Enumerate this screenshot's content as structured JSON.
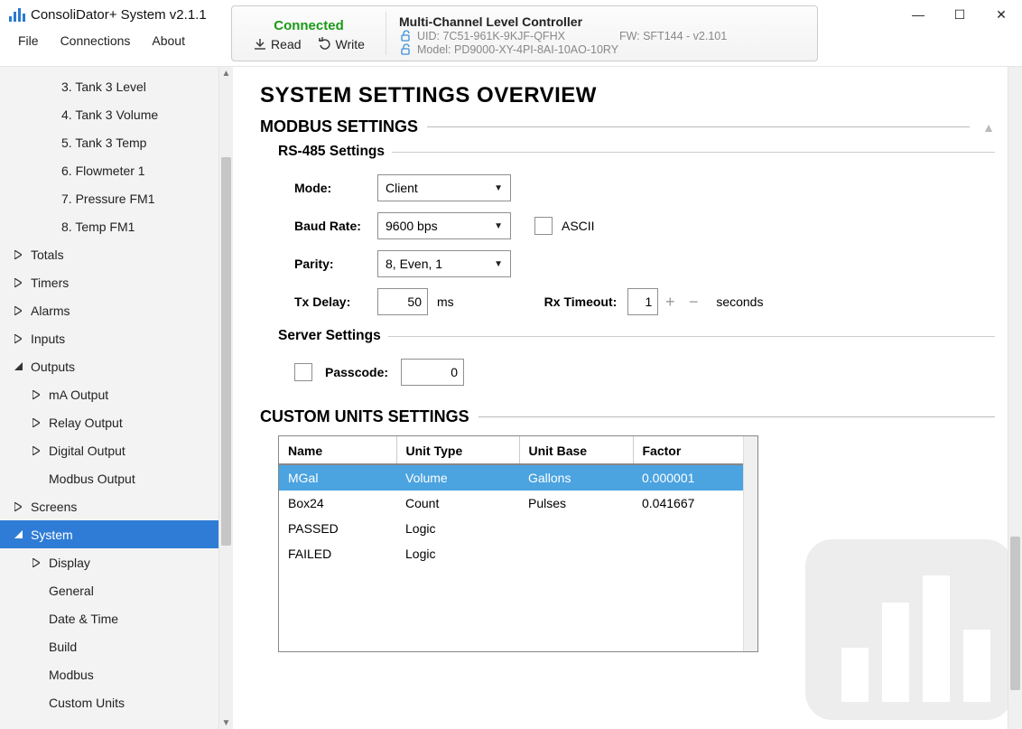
{
  "app": {
    "title": "ConsoliDator+ System v2.1.1"
  },
  "menu": {
    "file": "File",
    "connections": "Connections",
    "about": "About"
  },
  "infobar": {
    "status": "Connected",
    "read": "Read",
    "write": "Write",
    "device_title": "Multi-Channel Level Controller",
    "uid_label": "UID: 7C51-961K-9KJF-QFHX",
    "fw_label": "FW: SFT144 - v2.101",
    "model_label": "Model: PD9000-XY-4PI-8AI-10AO-10RY"
  },
  "window_controls": {
    "min": "—",
    "max": "☐",
    "close": "✕"
  },
  "sidebar": {
    "items": [
      {
        "label": "3. Tank 3 Level",
        "level": 3,
        "leaf": true
      },
      {
        "label": "4. Tank 3 Volume",
        "level": 3,
        "leaf": true
      },
      {
        "label": "5. Tank 3 Temp",
        "level": 3,
        "leaf": true
      },
      {
        "label": "6. Flowmeter 1",
        "level": 3,
        "leaf": true
      },
      {
        "label": "7. Pressure FM1",
        "level": 3,
        "leaf": true
      },
      {
        "label": "8. Temp FM1",
        "level": 3,
        "leaf": true
      },
      {
        "label": "Totals",
        "level": 1,
        "arrow": "▷"
      },
      {
        "label": "Timers",
        "level": 1,
        "arrow": "▷"
      },
      {
        "label": "Alarms",
        "level": 1,
        "arrow": "▷"
      },
      {
        "label": "Inputs",
        "level": 1,
        "arrow": "▷"
      },
      {
        "label": "Outputs",
        "level": 1,
        "arrow": "◢"
      },
      {
        "label": "mA Output",
        "level": 2,
        "arrow": "▷"
      },
      {
        "label": "Relay Output",
        "level": 2,
        "arrow": "▷"
      },
      {
        "label": "Digital Output",
        "level": 2,
        "arrow": "▷"
      },
      {
        "label": "Modbus Output",
        "level": 2,
        "leaf": true
      },
      {
        "label": "Screens",
        "level": 1,
        "arrow": "▷"
      },
      {
        "label": "System",
        "level": 1,
        "arrow": "◢",
        "selected": true
      },
      {
        "label": "Display",
        "level": 2,
        "arrow": "▷"
      },
      {
        "label": "General",
        "level": 2,
        "leaf": true
      },
      {
        "label": "Date & Time",
        "level": 2,
        "leaf": true
      },
      {
        "label": "Build",
        "level": 2,
        "leaf": true
      },
      {
        "label": "Modbus",
        "level": 2,
        "leaf": true
      },
      {
        "label": "Custom Units",
        "level": 2,
        "leaf": true
      }
    ]
  },
  "page": {
    "title": "SYSTEM SETTINGS OVERVIEW"
  },
  "modbus": {
    "header": "MODBUS SETTINGS",
    "rs485_header": "RS-485 Settings",
    "mode_label": "Mode:",
    "mode_value": "Client",
    "baud_label": "Baud Rate:",
    "baud_value": "9600 bps",
    "ascii_label": "ASCII",
    "parity_label": "Parity:",
    "parity_value": "8, Even, 1",
    "txdelay_label": "Tx Delay:",
    "txdelay_value": "50",
    "txdelay_unit": "ms",
    "rxtimeout_label": "Rx Timeout:",
    "rxtimeout_value": "1",
    "rxtimeout_unit": "seconds",
    "server_header": "Server Settings",
    "passcode_label": "Passcode:",
    "passcode_value": "0"
  },
  "custom_units": {
    "header": "CUSTOM UNITS SETTINGS",
    "columns": {
      "name": "Name",
      "unit_type": "Unit Type",
      "unit_base": "Unit Base",
      "factor": "Factor"
    },
    "rows": [
      {
        "name": "MGal",
        "type": "Volume",
        "base": "Gallons",
        "factor": "0.000001",
        "selected": true
      },
      {
        "name": "Box24",
        "type": "Count",
        "base": "Pulses",
        "factor": "0.041667"
      },
      {
        "name": "PASSED",
        "type": "Logic",
        "base": "",
        "factor": ""
      },
      {
        "name": "FAILED",
        "type": "Logic",
        "base": "",
        "factor": ""
      }
    ]
  }
}
